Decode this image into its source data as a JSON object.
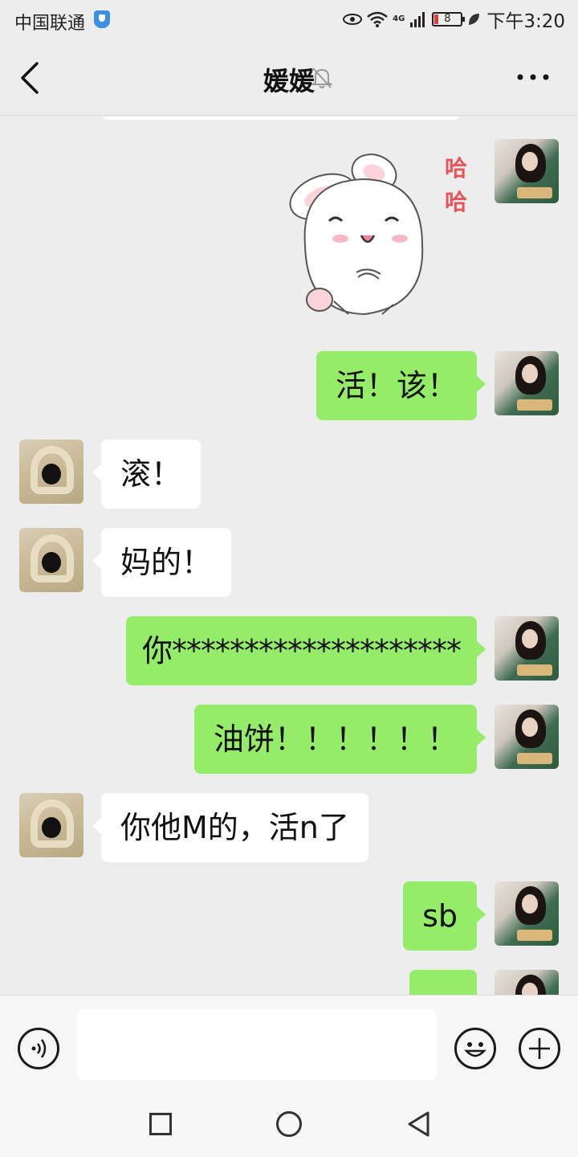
{
  "status_bar": {
    "carrier": "中国联通",
    "network": "4G",
    "battery": "8",
    "time": "下午3:20"
  },
  "header": {
    "title": "媛媛",
    "icons": [
      "back-icon",
      "mute-bell-icon",
      "more-icon"
    ]
  },
  "sticker": {
    "text_line1": "哈",
    "text_line2": "哈",
    "icon": "bunny-sticker"
  },
  "messages": [
    {
      "side": "right",
      "text": "活！该！"
    },
    {
      "side": "left",
      "text": "滚！"
    },
    {
      "side": "left",
      "text": "妈的！"
    },
    {
      "side": "right",
      "text": "你********************"
    },
    {
      "side": "right",
      "text": "油饼！！！！！！"
    },
    {
      "side": "left",
      "text": "你他M的，活n了"
    },
    {
      "side": "right",
      "text": "sb"
    }
  ],
  "input_bar": {
    "value": "",
    "icons": [
      "voice-icon",
      "emoji-icon",
      "plus-icon"
    ]
  },
  "nav_bar": {
    "icons": [
      "recents-icon",
      "home-icon",
      "back-triangle-icon"
    ]
  },
  "colors": {
    "background": "#ededed",
    "sent_bubble": "#95ec69",
    "received_bubble": "#ffffff",
    "sticker_text": "#e8545a"
  }
}
